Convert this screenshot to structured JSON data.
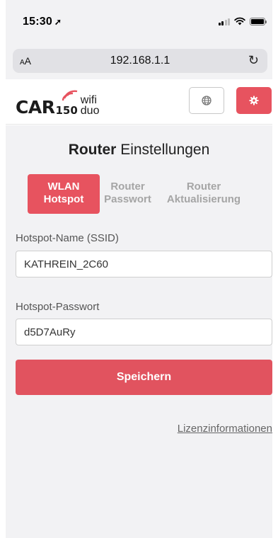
{
  "status_bar": {
    "time": "15:30",
    "location_icon": "location-arrow-icon",
    "signal_icon": "cellular-signal-icon",
    "wifi_icon": "wifi-icon",
    "battery_icon": "battery-icon"
  },
  "browser": {
    "text_size_label": "AA",
    "url": "192.168.1.1",
    "reload_icon": "reload-icon"
  },
  "header": {
    "logo_main": "CAR",
    "logo_number": "150",
    "logo_wifi": "wifi",
    "logo_duo": "duo",
    "language_icon": "globe-icon",
    "settings_icon": "gear-icon",
    "accent_color": "#e7535f"
  },
  "page": {
    "title_bold": "Router",
    "title_rest": "Einstellungen"
  },
  "tabs": [
    {
      "line1": "WLAN",
      "line2": "Hotspot",
      "active": true
    },
    {
      "line1": "Router",
      "line2": "Passwort",
      "active": false
    },
    {
      "line1": "Router",
      "line2": "Aktualisierung",
      "active": false
    }
  ],
  "form": {
    "ssid_label": "Hotspot-Name (SSID)",
    "ssid_value": "KATHREIN_2C60",
    "password_label": "Hotspot-Passwort",
    "password_value": "d5D7AuRy",
    "save_label": "Speichern"
  },
  "footer": {
    "license_link": "Lizenzinformationen"
  }
}
